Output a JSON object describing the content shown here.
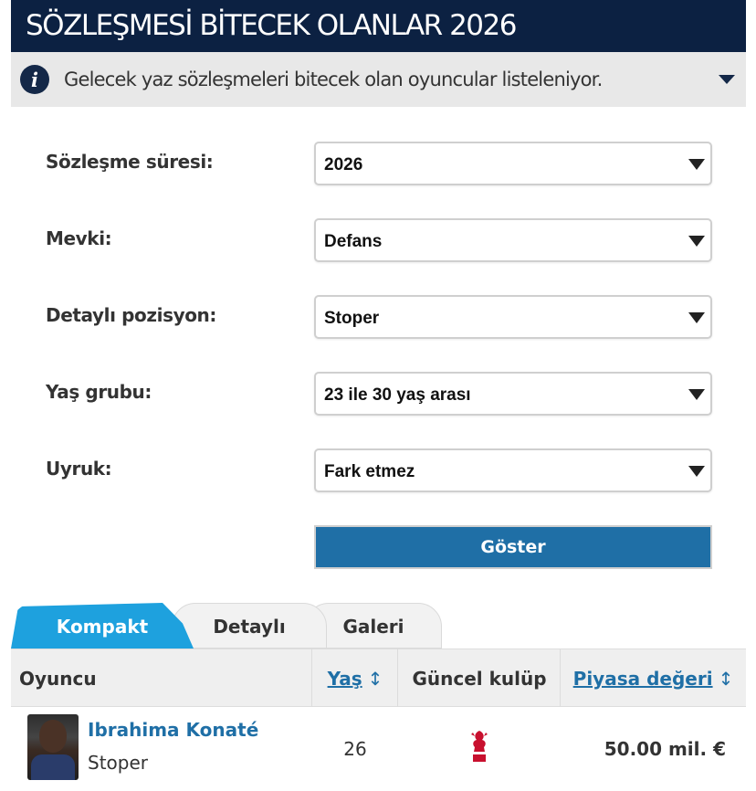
{
  "header": {
    "title": "SÖZLEŞMESİ BİTECEK OLANLAR 2026"
  },
  "info": {
    "text": "Gelecek yaz sözleşmeleri bitecek olan oyuncular listeleniyor.",
    "icon": "info-icon"
  },
  "filters": [
    {
      "label": "Sözleşme süresi:",
      "value": "2026"
    },
    {
      "label": "Mevki:",
      "value": "Defans"
    },
    {
      "label": "Detaylı pozisyon:",
      "value": "Stoper"
    },
    {
      "label": "Yaş grubu:",
      "value": "23 ile 30 yaş arası"
    },
    {
      "label": "Uyruk:",
      "value": "Fark etmez"
    }
  ],
  "show_button": "Göster",
  "tabs": [
    "Kompakt",
    "Detaylı",
    "Galeri"
  ],
  "active_tab": "Kompakt",
  "table": {
    "headers": {
      "player": "Oyuncu",
      "age": "Yaş",
      "club": "Güncel kulüp",
      "value": "Piyasa değeri"
    },
    "rows": [
      {
        "name": "Ibrahima Konaté",
        "position": "Stoper",
        "age": "26",
        "club_logo": "liverpool-crest",
        "value": "50.00 mil. €"
      }
    ]
  },
  "colors": {
    "header_bg": "#0c2142",
    "accent": "#1f6fa6",
    "active_tab": "#1ea1de",
    "club_red": "#c8102e"
  }
}
